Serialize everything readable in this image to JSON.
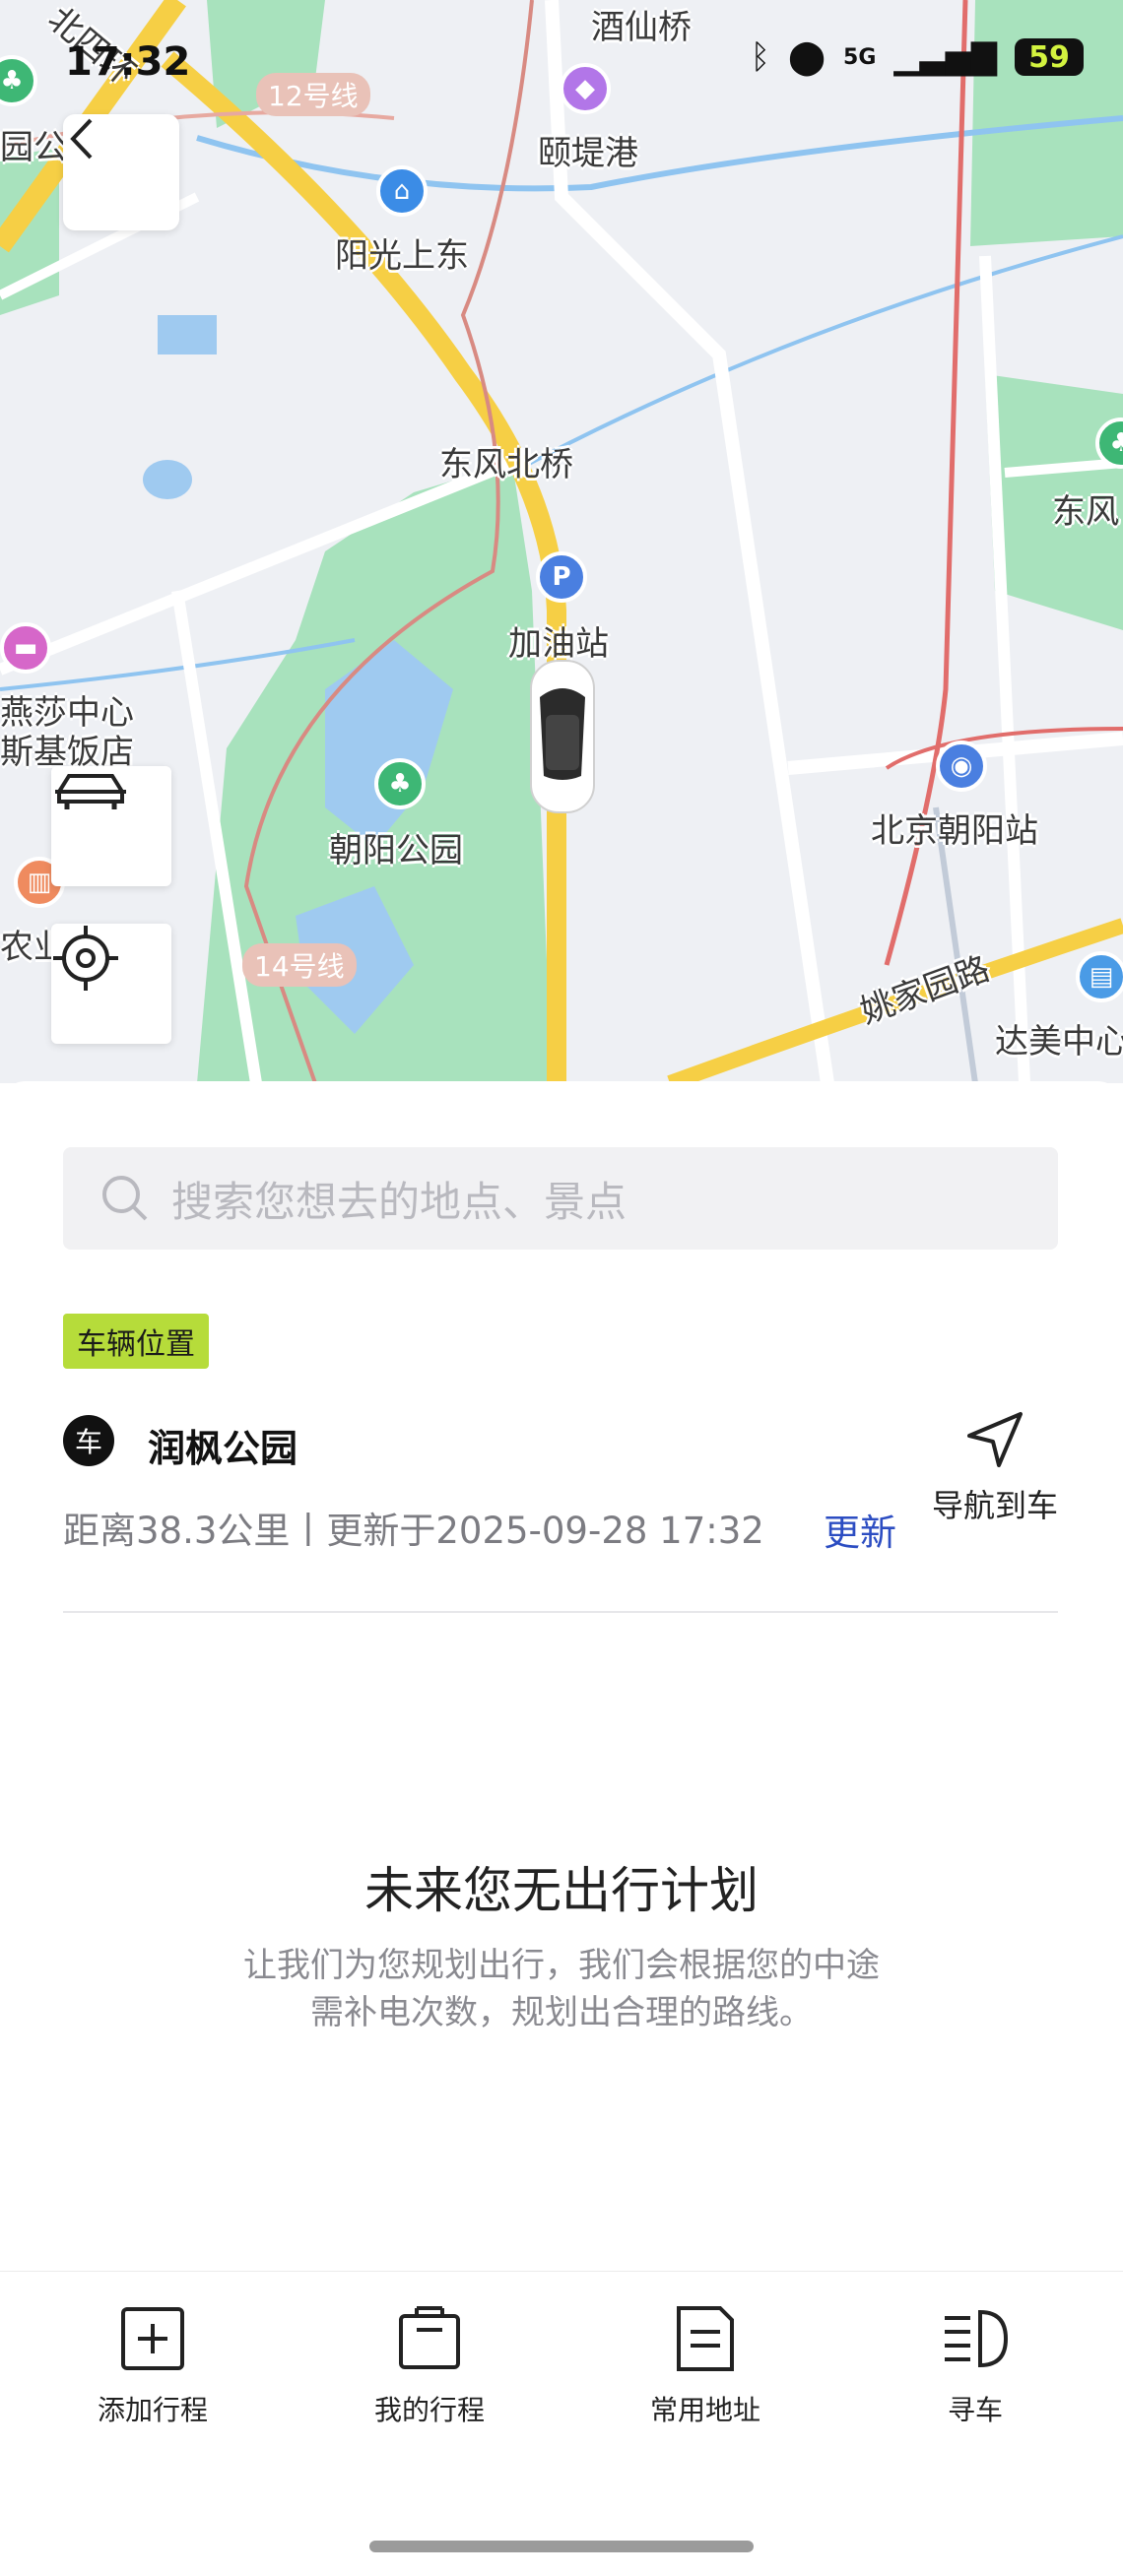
{
  "status_bar": {
    "time": "17:32",
    "network": "5G",
    "battery": "59"
  },
  "map": {
    "labels": {
      "jiuxianqiao": "酒仙桥",
      "yitigang": "颐堤港",
      "yangguangshangdong": "阳光上东",
      "dongfengbeiqiao": "东风北桥",
      "jiayouzhan": "加油站",
      "yanshazhongxin": "燕莎中心",
      "kempinski": "斯基饭店",
      "chaoyanggongyuan": "朝阳公园",
      "beijingchaoyangzhan": "北京朝阳站",
      "yaojiayuanlu": "姚家园路",
      "dameizhongxin": "达美中心",
      "dongfeng": "东风",
      "nongye": "农业",
      "yuangong": "园公",
      "beisihuan": "北四环"
    },
    "line_badges": {
      "line12": "12号线",
      "line14": "14号线"
    }
  },
  "search": {
    "placeholder": "搜索您想去的地点、景点"
  },
  "vehicle": {
    "tag": "车辆位置",
    "badge": "车",
    "place": "润枫公园",
    "info": "距离38.3公里丨更新于2025-09-28 17:32",
    "refresh_label": "更新",
    "navigate_label": "导航到车"
  },
  "empty_state": {
    "title": "未来您无出行计划",
    "desc_line1": "让我们为您规划出行，我们会根据您的中途",
    "desc_line2": "需补电次数，规划出合理的路线。"
  },
  "tabs": [
    {
      "label": "添加行程",
      "icon": "plus-square-icon"
    },
    {
      "label": "我的行程",
      "icon": "suitcase-icon"
    },
    {
      "label": "常用地址",
      "icon": "document-icon"
    },
    {
      "label": "寻车",
      "icon": "headlight-icon"
    }
  ],
  "colors": {
    "accent_blue": "#2c4dc2",
    "tag_green": "#b6dc3a",
    "park_green": "#a8e2bd",
    "road_yellow": "#f6cf45"
  }
}
